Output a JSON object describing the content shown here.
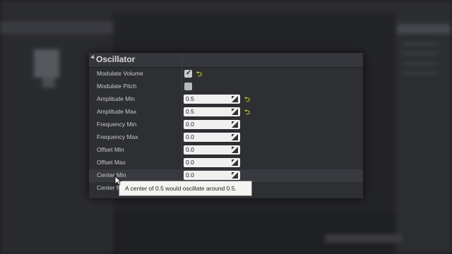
{
  "panel": {
    "title": "Oscillator",
    "rows": [
      {
        "label": "Modulate Volume",
        "type": "checkbox",
        "checked": true,
        "reset": true
      },
      {
        "label": "Modulate Pitch",
        "type": "checkbox",
        "checked": false,
        "reset": false
      },
      {
        "label": "Amplitude Min",
        "type": "number",
        "value": "0.5",
        "reset": true
      },
      {
        "label": "Amplitude Max",
        "type": "number",
        "value": "0.5",
        "reset": true
      },
      {
        "label": "Frequency Min",
        "type": "number",
        "value": "0.0",
        "reset": false
      },
      {
        "label": "Frequency Max",
        "type": "number",
        "value": "0.0",
        "reset": false
      },
      {
        "label": "Offset Min",
        "type": "number",
        "value": "0.0",
        "reset": false
      },
      {
        "label": "Offset Max",
        "type": "number",
        "value": "0.0",
        "reset": false
      },
      {
        "label": "Center Min",
        "type": "number",
        "value": "0.0",
        "reset": false
      },
      {
        "label": "Center M",
        "type": "number",
        "value": "",
        "reset": false
      }
    ]
  },
  "tooltip": {
    "text": "A center of 0.5 would oscillate around 0.5."
  },
  "colors": {
    "reset_arrow": "#c6c51c",
    "panel_bg": "#2e2f33"
  },
  "icons": {
    "reset": "reset-arrow-icon",
    "drag": "drag-handle-icon",
    "collapse": "collapse-arrow-icon"
  }
}
